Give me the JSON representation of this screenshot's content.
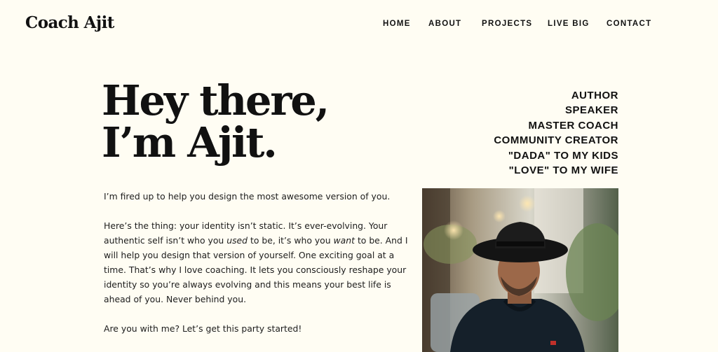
{
  "header": {
    "logo": "Coach Ajit",
    "nav": [
      {
        "label": "HOME"
      },
      {
        "label": "ABOUT"
      },
      {
        "label": "PROJECTS"
      },
      {
        "label": "LIVE BIG"
      },
      {
        "label": "CONTACT"
      }
    ]
  },
  "hero": {
    "headline_line1": "Hey there,",
    "headline_line2": "I’m Ajit.",
    "roles": [
      "AUTHOR",
      "SPEAKER",
      "MASTER COACH",
      "COMMUNITY CREATOR",
      "\"DADA\" TO MY KIDS",
      "\"LOVE\" TO MY WIFE"
    ]
  },
  "content": {
    "intro": "I’m fired up to help you design the most awesome version of you.",
    "para2_a": "Here’s the thing: your identity isn’t static. It’s ever-evolving. Your authentic self isn’t who you ",
    "para2_em1": "used",
    "para2_b": " to be, it’s who you ",
    "para2_em2": "want",
    "para2_c": " to be. And I will help you design that version of yourself. One exciting goal at a time. That’s why I love coaching. It lets you consciously reshape your identity so you’re always evolving and this means your best life is ahead of you. Never behind you.",
    "closing": "Are you with me? Let’s get this party started!"
  },
  "colors": {
    "background": "#fffdf3",
    "text": "#111111"
  }
}
